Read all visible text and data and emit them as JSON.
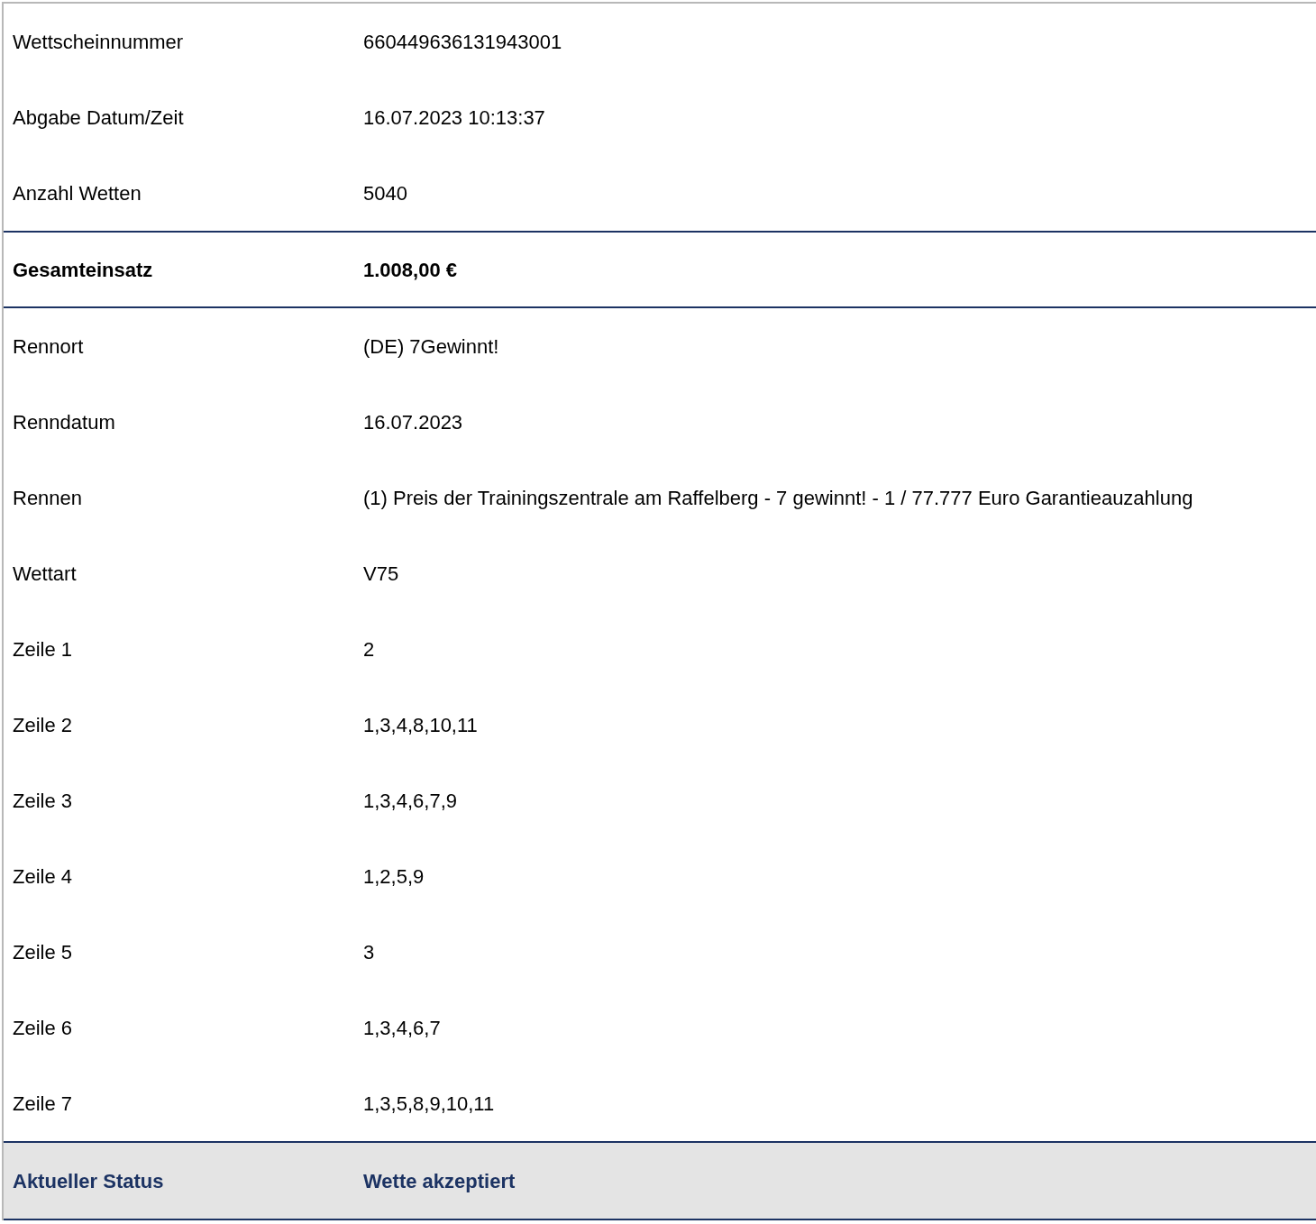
{
  "rows": [
    {
      "kind": "plain",
      "label": "Wettscheinnummer",
      "value": "660449636131943001"
    },
    {
      "kind": "plain",
      "label": "Abgabe Datum/Zeit",
      "value": "16.07.2023 10:13:37"
    },
    {
      "kind": "plain",
      "label": "Anzahl Wetten",
      "value": "5040"
    },
    {
      "kind": "total",
      "label": "Gesamteinsatz",
      "value": "1.008,00 €"
    },
    {
      "kind": "plain",
      "label": "Rennort",
      "value": "(DE) 7Gewinnt!"
    },
    {
      "kind": "plain",
      "label": "Renndatum",
      "value": "16.07.2023"
    },
    {
      "kind": "plain",
      "label": "Rennen",
      "value": "(1) Preis der Trainingszentrale am Raffelberg - 7 gewinnt! - 1 / 77.777 Euro Garantieauzahlung"
    },
    {
      "kind": "plain",
      "label": "Wettart",
      "value": "V75"
    },
    {
      "kind": "plain",
      "label": "Zeile 1",
      "value": "2"
    },
    {
      "kind": "plain",
      "label": "Zeile 2",
      "value": "1,3,4,8,10,11"
    },
    {
      "kind": "plain",
      "label": "Zeile 3",
      "value": "1,3,4,6,7,9"
    },
    {
      "kind": "plain",
      "label": "Zeile 4",
      "value": "1,2,5,9"
    },
    {
      "kind": "plain",
      "label": "Zeile 5",
      "value": "3"
    },
    {
      "kind": "plain",
      "label": "Zeile 6",
      "value": "1,3,4,6,7"
    },
    {
      "kind": "plain",
      "label": "Zeile 7",
      "value": "1,3,5,8,9,10,11"
    },
    {
      "kind": "status",
      "label": "Aktueller Status",
      "value": "Wette akzeptiert"
    }
  ]
}
